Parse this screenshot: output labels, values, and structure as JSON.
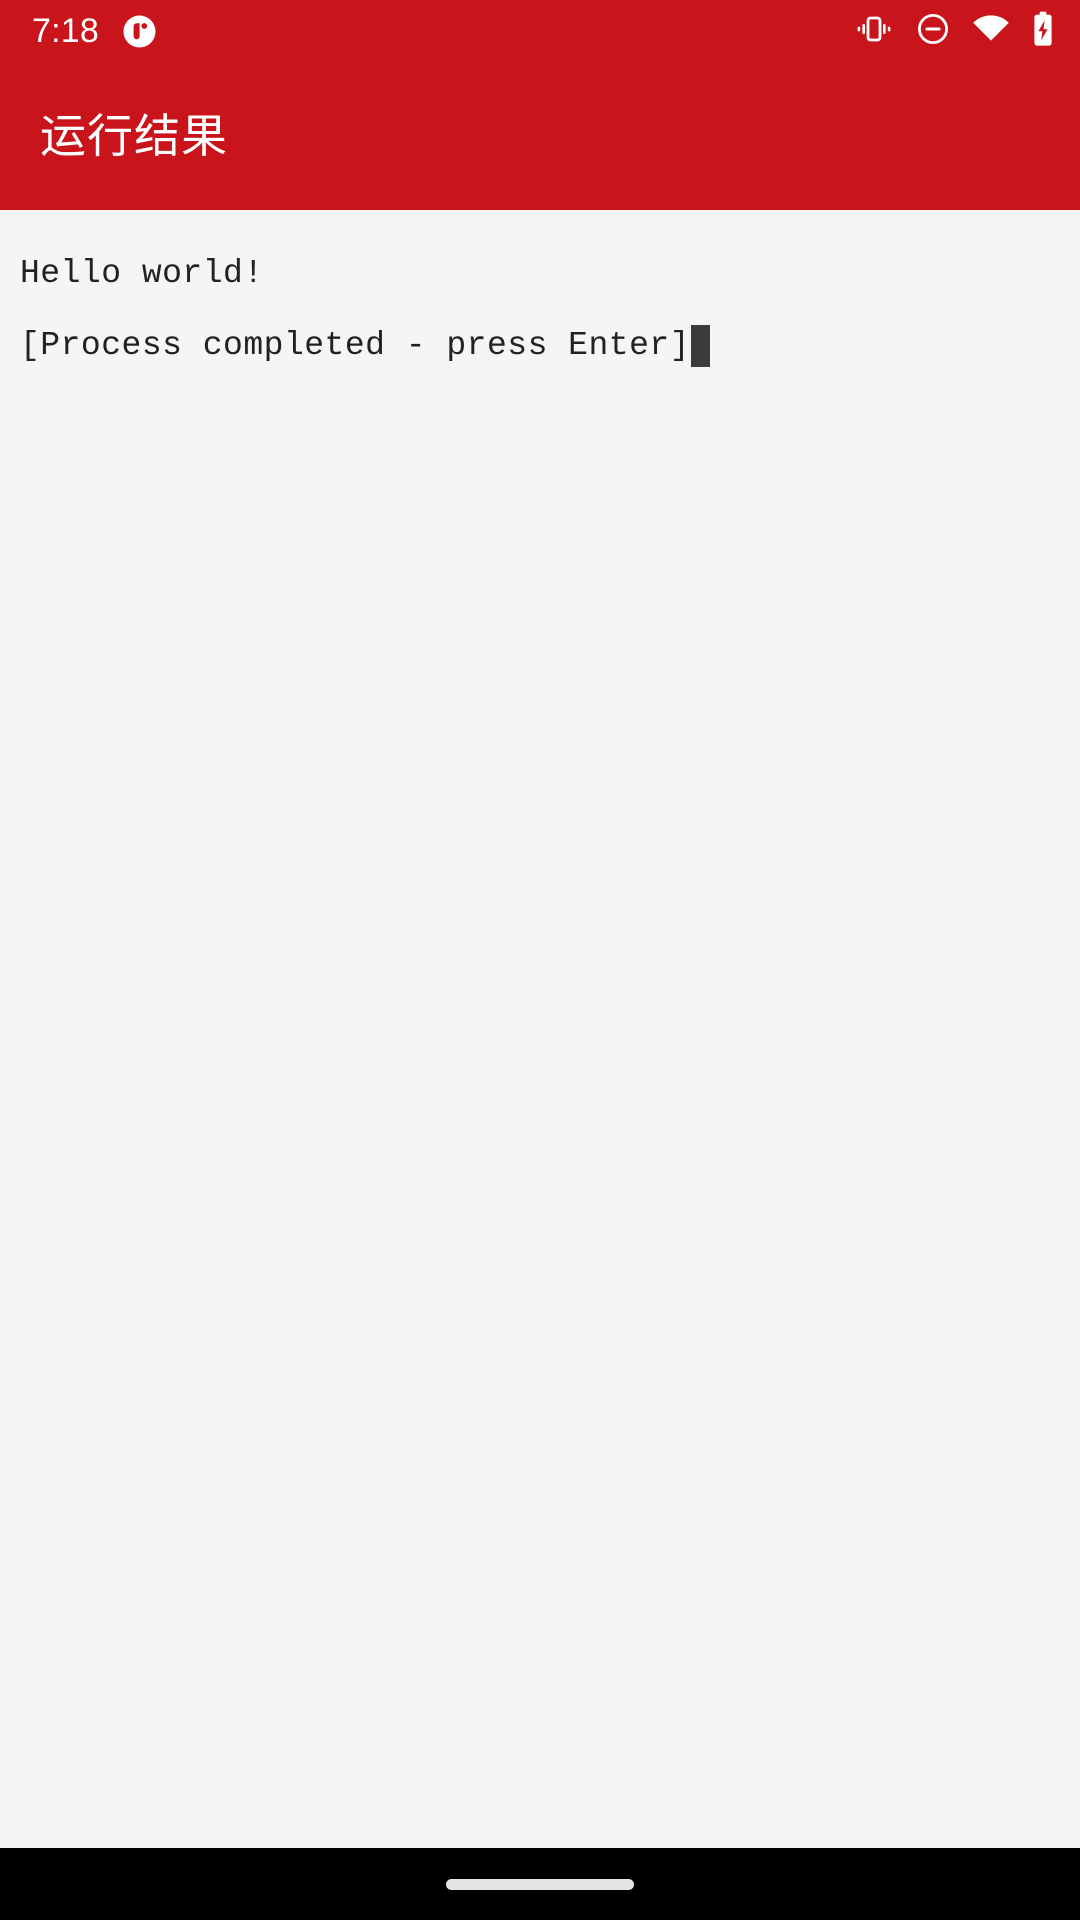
{
  "status_bar": {
    "time": "7:18",
    "background_color": "#c8141a",
    "foreground_color": "#ffffff",
    "notification_icon": "qpython-app-icon",
    "icons": [
      {
        "name": "vibrate-icon",
        "label": "Vibrate"
      },
      {
        "name": "do-not-disturb-icon",
        "label": "Do not disturb"
      },
      {
        "name": "wifi-icon",
        "label": "Wi-Fi"
      },
      {
        "name": "battery-charging-icon",
        "label": "Battery charging"
      }
    ]
  },
  "app_bar": {
    "title": "运行结果",
    "background_color": "#c8141a",
    "title_color": "#ffffff"
  },
  "terminal": {
    "background_color": "#f5f5f5",
    "text_color": "#222222",
    "cursor_color": "#3b3b3b",
    "lines": [
      "Hello world!",
      "[Process completed - press Enter]"
    ]
  },
  "navigation_bar": {
    "background_color": "#000000",
    "handle": "gesture-home-handle",
    "handle_color": "#e4e4e4"
  }
}
